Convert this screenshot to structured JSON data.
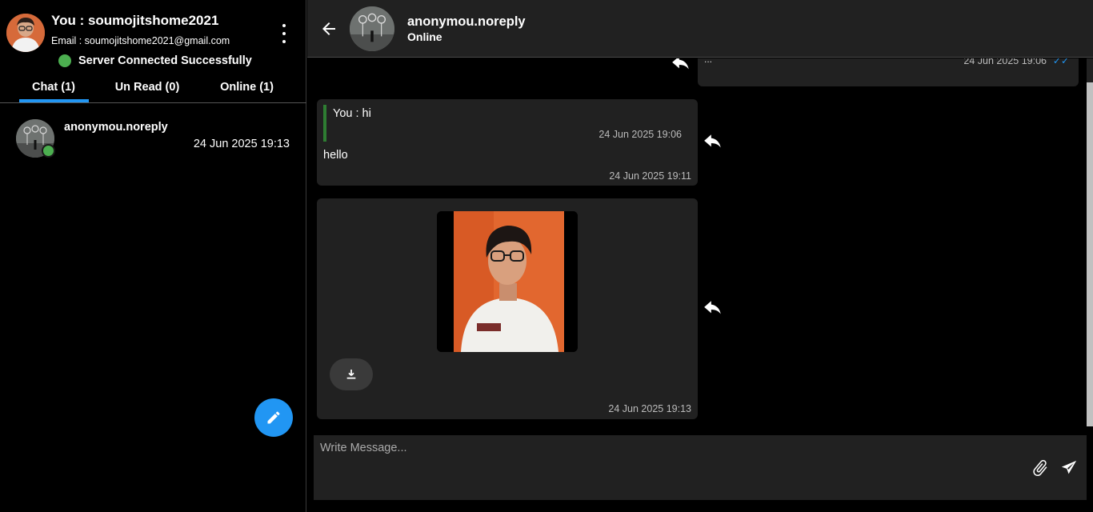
{
  "sidebar": {
    "profile": {
      "name": "You : soumojitshome2021",
      "email": "Email : soumojitshome2021@gmail.com"
    },
    "server_status": "Server Connected Successfully",
    "tabs": [
      {
        "label": "Chat (1)",
        "active": true
      },
      {
        "label": "Un Read (0)",
        "active": false
      },
      {
        "label": "Online (1)",
        "active": false
      }
    ],
    "chats": [
      {
        "name": "anonymou.noreply",
        "time": "24 Jun 2025 19:13",
        "online": true
      }
    ]
  },
  "header": {
    "name": "anonymou.noreply",
    "status": "Online"
  },
  "messages": [
    {
      "text": "...",
      "time": "24 Jun 2025 19:06",
      "ticks": "✓✓"
    },
    {
      "quote": "You : hi",
      "quote_time": "24 Jun 2025 19:06",
      "text": "hello",
      "time": "24 Jun 2025 19:11"
    },
    {
      "type": "image",
      "time": "24 Jun 2025 19:13"
    }
  ],
  "composer": {
    "placeholder": "Write Message..."
  },
  "colors": {
    "accent": "#2196f3",
    "online": "#4caf50",
    "bubble": "#212121",
    "quote_bar": "#2e7d32"
  },
  "icons": [
    "menu-dots-icon",
    "back-arrow-icon",
    "reply-icon",
    "download-icon",
    "attach-icon",
    "send-icon",
    "edit-pencil-icon"
  ]
}
